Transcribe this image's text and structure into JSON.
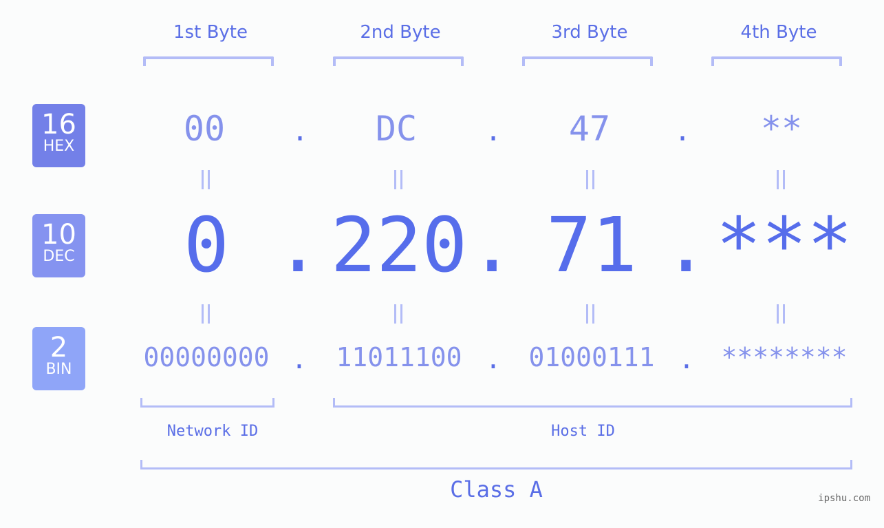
{
  "byte_headers": [
    "1st Byte",
    "2nd Byte",
    "3rd Byte",
    "4th Byte"
  ],
  "badges": {
    "hex": {
      "num": "16",
      "label": "HEX",
      "color": "#7380e8"
    },
    "dec": {
      "num": "10",
      "label": "DEC",
      "color": "#8593f0"
    },
    "bin": {
      "num": "2",
      "label": "BIN",
      "color": "#8fa5f8"
    }
  },
  "hex": [
    "00",
    "DC",
    "47",
    "**"
  ],
  "dec": [
    "0",
    "220",
    "71",
    "***"
  ],
  "bin": [
    "00000000",
    "11011100",
    "01000111",
    "********"
  ],
  "separator": ".",
  "network_label": "Network ID",
  "host_label": "Host ID",
  "class_label": "Class A",
  "watermark": "ipshu.com",
  "colors": {
    "primary": "#566deb",
    "secondary": "#8592ec",
    "bracket": "#b3bcf7",
    "background": "#fbfcfc"
  }
}
